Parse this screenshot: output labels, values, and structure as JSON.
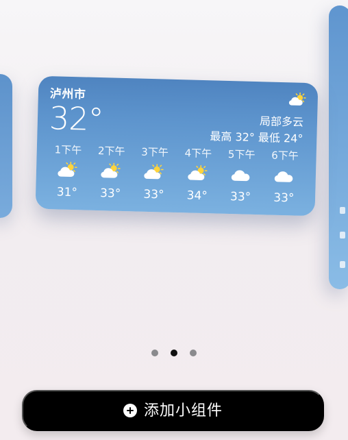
{
  "widget": {
    "city": "泸州市",
    "current_temp": "32°",
    "condition": "局部多云",
    "range": "最高 32° 最低 24°",
    "header_icon": "partly-sunny-icon",
    "hourly": [
      {
        "time": "1下午",
        "icon": "partly-sunny-icon",
        "temp": "31°"
      },
      {
        "time": "2下午",
        "icon": "partly-sunny-icon",
        "temp": "33°"
      },
      {
        "time": "3下午",
        "icon": "partly-sunny-icon",
        "temp": "33°"
      },
      {
        "time": "4下午",
        "icon": "partly-sunny-icon",
        "temp": "34°"
      },
      {
        "time": "5下午",
        "icon": "cloud-icon",
        "temp": "33°"
      },
      {
        "time": "6下午",
        "icon": "cloud-icon",
        "temp": "33°"
      }
    ]
  },
  "pager": {
    "count": 3,
    "active_index": 1
  },
  "bottom": {
    "add_label": "添加小组件",
    "add_icon": "plus-circle-icon"
  },
  "colors": {
    "widget_top": "#4f84c0",
    "widget_bottom": "#7bb1e0",
    "button_bg": "#000000",
    "button_text": "#ffffff",
    "dot_inactive": "#8a8a8d",
    "dot_active": "#111111"
  }
}
